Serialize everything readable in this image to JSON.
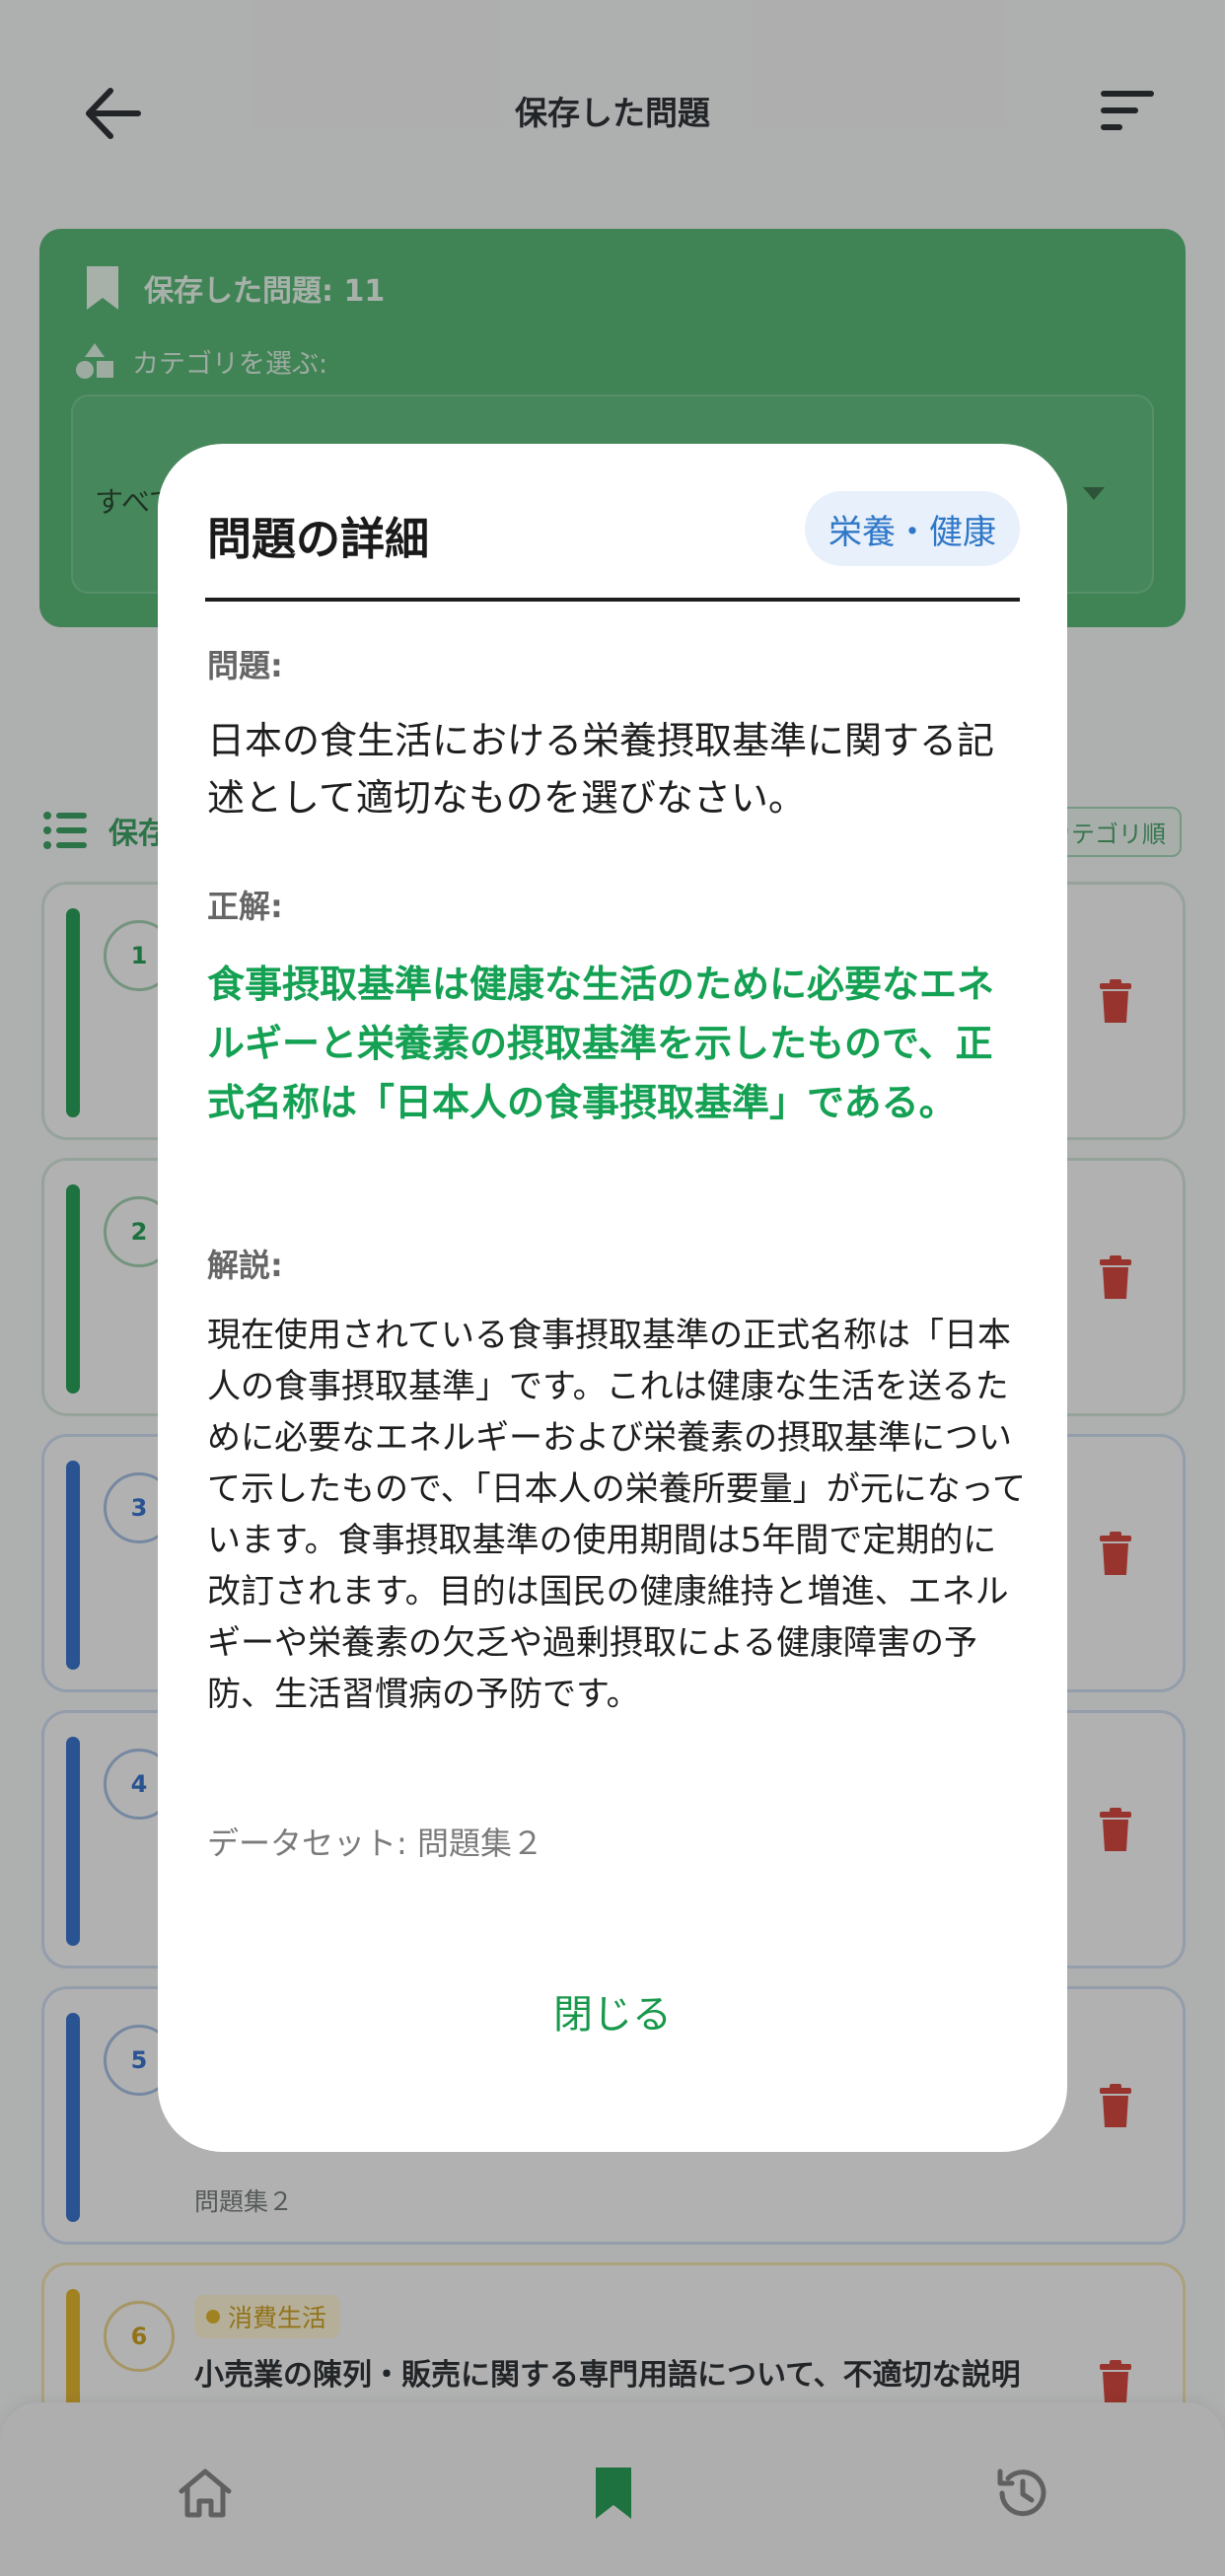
{
  "header": {
    "title": "保存した問題"
  },
  "summary": {
    "count_label": "保存した問題: 11",
    "category_label": "カテゴリを選ぶ:",
    "category_value": "すべて"
  },
  "list": {
    "title": "保存",
    "sort_label": "カテゴリ順"
  },
  "cards": [
    {
      "number": "1",
      "color": "#17984b"
    },
    {
      "number": "2",
      "color": "#17984b"
    },
    {
      "number": "3",
      "color": "#2b69c8"
    },
    {
      "number": "4",
      "color": "#2b69c8"
    },
    {
      "number": "5",
      "color": "#2b69c8",
      "dataset": "問題集２"
    },
    {
      "number": "6",
      "color": "#e0b021",
      "badge": "消費生活",
      "question": "小売業の陳列・販売に関する専門用語について、不適切な説明"
    }
  ],
  "modal": {
    "title": "問題の詳細",
    "tag": "栄養・健康",
    "question_label": "問題:",
    "question": "日本の食生活における栄養摂取基準に関する記述として適切なものを選びなさい。",
    "answer_label": "正解:",
    "answer": "食事摂取基準は健康な生活のために必要なエネルギーと栄養素の摂取基準を示したもので、正式名称は「日本人の食事摂取基準」である。",
    "explanation_label": "解説:",
    "explanation": "現在使用されている食事摂取基準の正式名称は「日本人の食事摂取基準」です。これは健康な生活を送るために必要なエネルギーおよび栄養素の摂取基準について示したもので、「日本人の栄養所要量」が元になっています。食事摂取基準の使用期間は5年間で定期的に改訂されます。目的は国民の健康維持と増進、エネルギーや栄養素の欠乏や過剰摂取による健康障害の予防、生活習慣病の予防です。",
    "dataset": "データセット: 問題集２",
    "close_label": "閉じる"
  },
  "colors": {
    "accent": "#17984b",
    "tag_text": "#2f77c8",
    "danger": "#d03a2f"
  },
  "nav": {
    "items": [
      "home-icon",
      "bookmark-icon",
      "history-icon"
    ],
    "active": "bookmark-icon"
  }
}
